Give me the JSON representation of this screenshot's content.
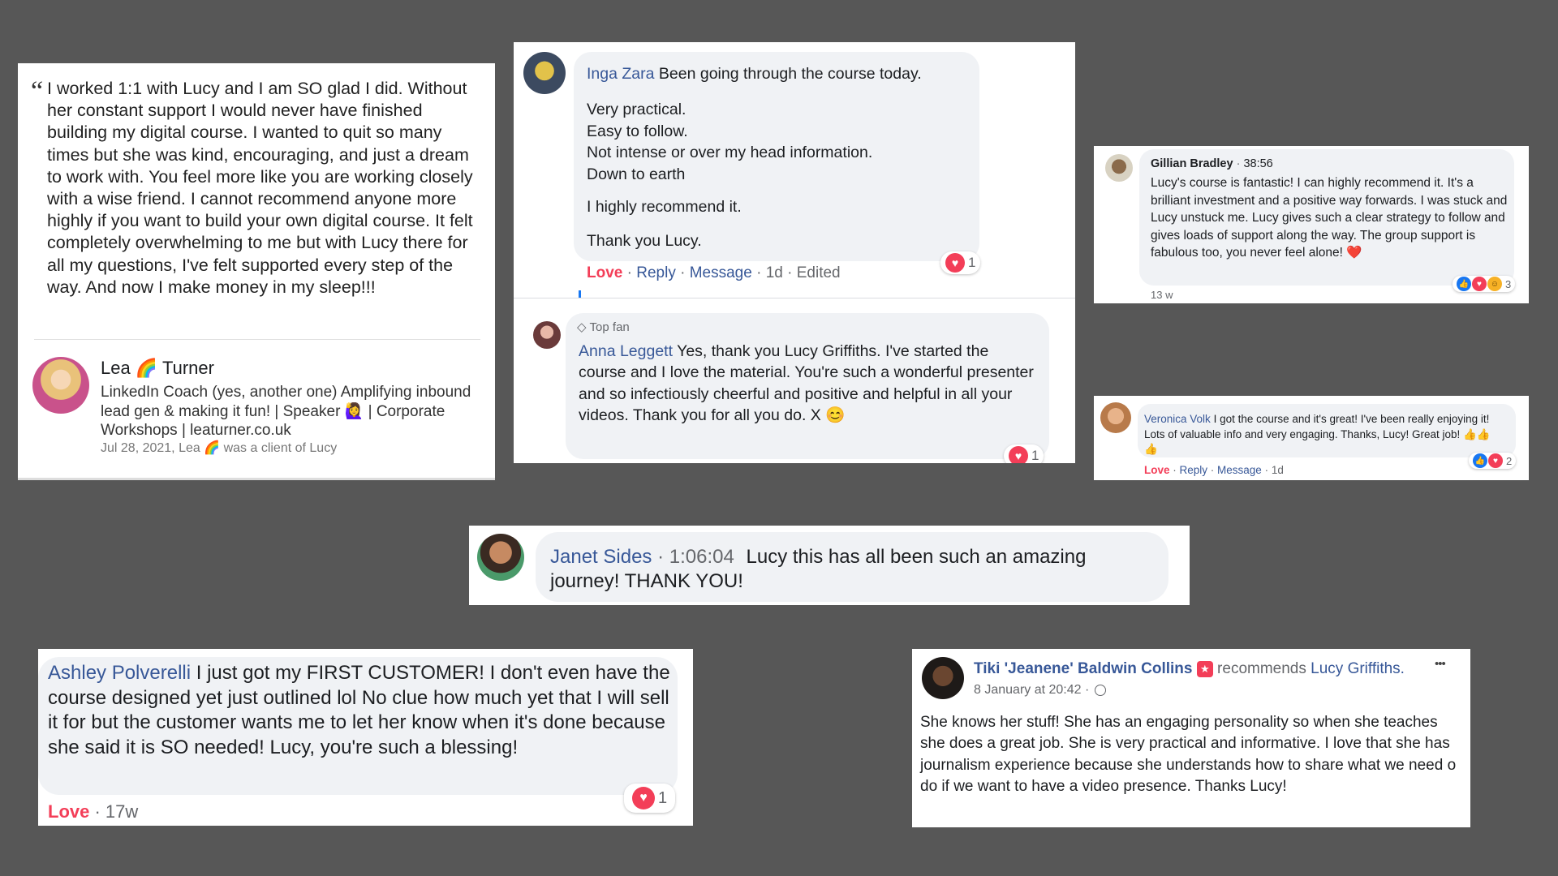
{
  "lea_card": {
    "quote_mark": "“",
    "quote": "I worked 1:1 with Lucy and I am SO glad I did. Without her constant support I would never have finished building my digital course. I wanted to quit so many times but she was kind, encouraging, and just a dream to work with. You feel more like you are working closely with a wise friend. I cannot recommend anyone more highly if you want to build your own digital course. It felt completely overwhelming to me but with Lucy there for all my questions, I've felt supported every step of the way. And now I make money in my sleep!!!",
    "name_first": "Lea",
    "name_emoji": "🌈",
    "name_last": "Turner",
    "headline": "LinkedIn Coach (yes, another one) Amplifying inbound lead gen & making it fun! | Speaker 🙋‍♀️ | Corporate Workshops | leaturner.co.uk",
    "meta": "Jul 28, 2021, Lea 🌈 was a client of Lucy"
  },
  "inga_card": {
    "name": "Inga Zara",
    "first_line": "Been going through the course today.",
    "body": "Very practical.\nEasy to follow.\nNot intense or over my head information.\nDown to earth",
    "line2": "I highly recommend it.",
    "line3": "Thank you Lucy.",
    "actions": {
      "love": "Love",
      "reply": "Reply",
      "message": "Message",
      "time": "1d",
      "edited": "Edited"
    },
    "reaction_count": "1",
    "anna": {
      "badge": "Top fan",
      "name": "Anna Leggett",
      "text": "Yes, thank you Lucy Griffiths. I've started the course and I love the material. You're such a wonderful presenter and so infectiously cheerful and positive and helpful in all your videos. Thank you for all you do. X 😊",
      "reaction_count": "1"
    }
  },
  "gillian_card": {
    "name": "Gillian Bradley",
    "timestamp": "38:56",
    "text": "Lucy's course is fantastic! I can highly recommend it. It's a brilliant investment and a positive way forwards. I was stuck and Lucy unstuck me. Lucy gives such a clear strategy to follow and gives loads of support along the way. The group support is fabulous too, you never feel alone! ❤️",
    "time": "13 w",
    "reaction_count": "3"
  },
  "veronica_card": {
    "name": "Veronica Volk",
    "text": "I got the course and it's great! I've been really enjoying it! Lots of valuable info and very engaging. Thanks, Lucy! Great job! 👍👍👍",
    "actions": {
      "love": "Love",
      "reply": "Reply",
      "message": "Message",
      "time": "1d"
    },
    "reaction_count": "2"
  },
  "janet_card": {
    "name": "Janet Sides",
    "timestamp": "1:06:04",
    "text": "Lucy this has all been such an amazing journey! THANK YOU!"
  },
  "ashley_card": {
    "name": "Ashley Polverelli",
    "text": "I just got my FIRST CUSTOMER! I don't even have the course designed yet just outlined lol No clue how much yet that I will sell it for but the customer wants me to let her know when it's done because she said it is SO needed! Lucy, you're such a blessing!",
    "love": "Love",
    "time": "· 17w",
    "reaction_count": "1"
  },
  "tiki_card": {
    "name": "Tiki 'Jeanene' Baldwin Collins",
    "recommends": "recommends",
    "page": "Lucy Griffiths.",
    "date": "8 January at 20:42 ·",
    "more": "•••",
    "text": "She knows her stuff! She has an engaging personality so when she teaches she does a great job. She is very practical and informative. I love that she has journalism experience because she understands how to share what we need o do if we want to have a video presence. Thanks Lucy!"
  },
  "colors": {
    "background": "#575757",
    "fb_blue": "#385898",
    "love_red": "#f33e58",
    "bubble": "#f0f2f5"
  }
}
